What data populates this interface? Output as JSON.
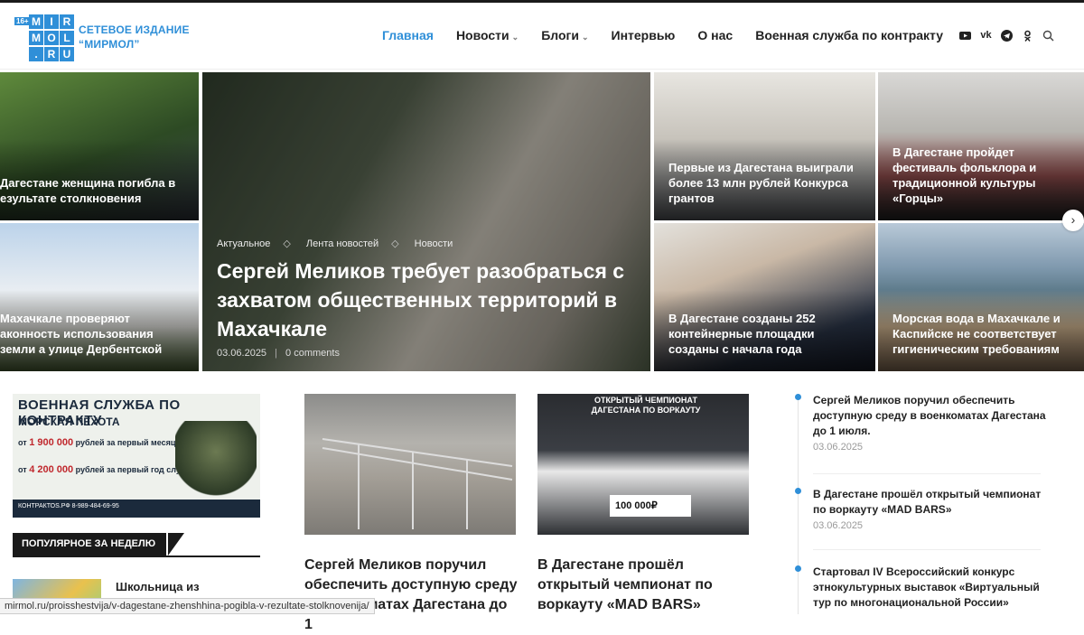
{
  "site": {
    "age_badge": "16+",
    "logo_letters": [
      "M",
      "I",
      "R",
      "M",
      "O",
      "L",
      ".",
      "R",
      "U"
    ],
    "name_line1": "СЕТЕВОЕ ИЗДАНИЕ",
    "name_line2": "“МИРМОЛ”",
    "accent": "#2f8fd8"
  },
  "nav": {
    "items": [
      {
        "label": "Главная",
        "active": true
      },
      {
        "label": "Новости",
        "has_dropdown": true
      },
      {
        "label": "Блоги",
        "has_dropdown": true
      },
      {
        "label": "Интервью"
      },
      {
        "label": "О нас"
      },
      {
        "label": "Военная служба по контракту"
      }
    ],
    "social_icons": [
      "youtube-icon",
      "vk-icon",
      "telegram-icon",
      "odnoklassniki-icon",
      "search-icon"
    ]
  },
  "hero": {
    "main": {
      "tags": [
        "Актуальное",
        "Лента новостей",
        "Новости"
      ],
      "title": "Сергей Меликов требует разобраться с захватом общественных территорий в Махачкале",
      "date": "03.06.2025",
      "comments": "0 comments"
    },
    "tiles": [
      {
        "caption": "Дагестане женщина погибла в езультате столкновения"
      },
      {
        "caption": "Махачкале проверяют аконность использования земли а улице Дербентской"
      },
      {
        "caption": "Первые из Дагестана выиграли более 13 млн рублей Конкурса грантов"
      },
      {
        "caption": "В Дагестане пройдет фестиваль фольклора и традиционной культуры «Горцы»"
      },
      {
        "caption": "В Дагестане созданы 252 контейнерные площадки созданы с начала года"
      },
      {
        "caption": "Морская вода в Махачкале и Каспийске не соответствует гигиеническим требованиям"
      }
    ]
  },
  "banner": {
    "title": "ВОЕННАЯ СЛУЖБА ПО КОНТРАКТУ",
    "subtitle": "МОРСКАЯ ПЕХОТА",
    "amount1": "1 900 000",
    "amount1_text": "рублей за первый месяц службы",
    "amount2": "4 200 000",
    "amount2_text": "рублей за первый год службы",
    "footer": "КОНТРАКТОS.РФ   8-989-484-69-95"
  },
  "popular": {
    "label": "ПОПУЛЯРНОЕ ЗА НЕДЕЛЮ",
    "first_item": "Школьница из Дагестана"
  },
  "cards": [
    {
      "title": "Сергей Меликов поручил обеспечить доступную среду в военкоматах Дагестана до 1"
    },
    {
      "title": "В Дагестане прошёл открытый чемпионат по воркауту «MAD BARS»"
    }
  ],
  "card_image_text": {
    "championship": "ОТКРЫТЫЙ ЧЕМПИОНАТ ДАГЕСТАНА ПО ВОРКАУТУ",
    "prize": "100 000₽"
  },
  "timeline": [
    {
      "title": "Сергей Меликов поручил обеспечить доступную среду в военкоматах Дагестана до 1 июля.",
      "date": "03.06.2025"
    },
    {
      "title": "В Дагестане прошёл открытый чемпионат по воркауту «MAD BARS»",
      "date": "03.06.2025"
    },
    {
      "title": "Стартовал IV Всероссийский конкурс этнокультурных выставок «Виртуальный тур по многонациональной России»",
      "date": ""
    }
  ],
  "status_url": "mirmol.ru/proisshestvija/v-dagestane-zhenshhina-pogibla-v-rezultate-stolknovenija/"
}
